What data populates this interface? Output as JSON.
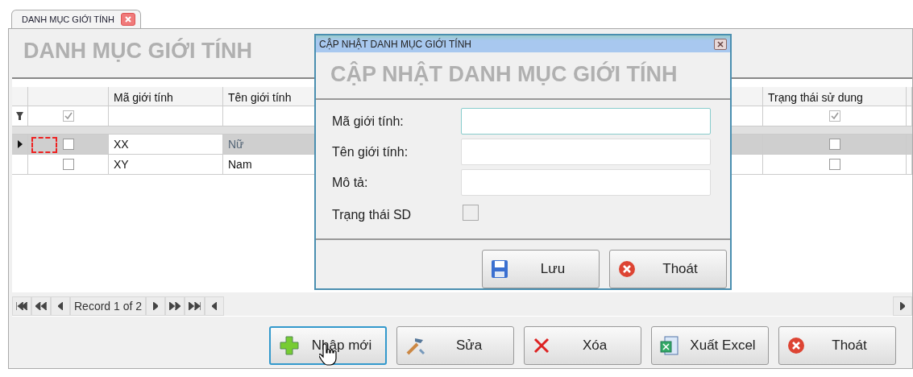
{
  "tab": {
    "label": "DANH MỤC GIỚI TÍNH",
    "selected": true
  },
  "title": "DANH MỤC GIỚI TÍNH",
  "grid": {
    "columns": [
      "Mã giới tính",
      "Tên giới tính",
      "Trạng thái sử dung"
    ],
    "filter": {
      "checked": true,
      "status_checked": true
    },
    "rows": [
      {
        "code": "XX",
        "name": "Nữ",
        "checked": false,
        "status": false,
        "selected": true
      },
      {
        "code": "XY",
        "name": "Nam",
        "checked": false,
        "status": false,
        "selected": false
      }
    ]
  },
  "navigator": {
    "record": "Record 1 of 2"
  },
  "buttons": [
    {
      "label": "Nhập mới",
      "focused": true
    },
    {
      "label": "Sửa",
      "focused": false
    },
    {
      "label": "Xóa",
      "focused": false
    },
    {
      "label": "Xuất Excel",
      "focused": false
    },
    {
      "label": "Thoát",
      "focused": false
    }
  ],
  "dialog": {
    "title": "CẬP NHẬT DANH MỤC GIỚI TÍNH",
    "heading": "CẬP NHẬT DANH MỤC GIỚI TÍNH",
    "fields": [
      {
        "label": "Mã giới tính:",
        "kind": "text",
        "focused": true
      },
      {
        "label": "Tên giới tính:",
        "kind": "text",
        "focused": false
      },
      {
        "label": "Mô tả:",
        "kind": "text",
        "focused": false
      },
      {
        "label": "Trạng thái SD",
        "kind": "checkbox",
        "checked": false
      }
    ],
    "buttons": [
      {
        "label": "Lưu"
      },
      {
        "label": "Thoát"
      }
    ]
  }
}
